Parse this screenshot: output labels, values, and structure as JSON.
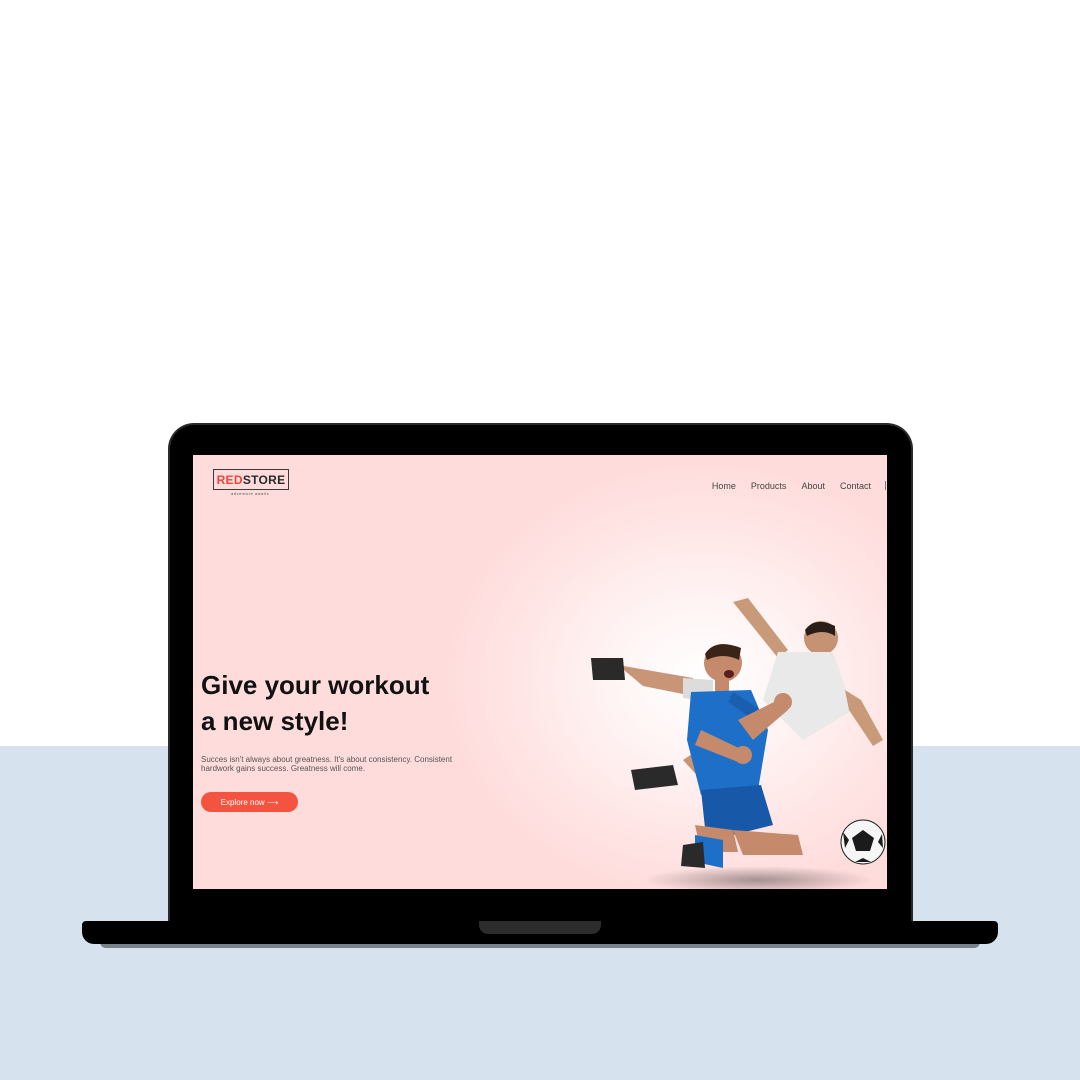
{
  "site": {
    "logo": {
      "part_red": "RED",
      "part_dark": "STORE",
      "tagline": "adventure awaits"
    },
    "nav": [
      {
        "label": "Home"
      },
      {
        "label": "Products"
      },
      {
        "label": "About"
      },
      {
        "label": "Contact"
      }
    ]
  },
  "hero": {
    "title_line1": "Give your workout",
    "title_line2": "a new style!",
    "subtitle_line1": "Succes isn't always about greatness. It's about consistency. Consistent",
    "subtitle_line2": "hardwork gains success. Greatness will come.",
    "cta_label": "Explore now ⟶",
    "image_description_icon": "football-players-illustration"
  },
  "colors": {
    "accent": "#f4533f",
    "screen_bg": "#ffdcdc",
    "page_bottom": "#d6e3ef",
    "text_dark": "#111111"
  }
}
